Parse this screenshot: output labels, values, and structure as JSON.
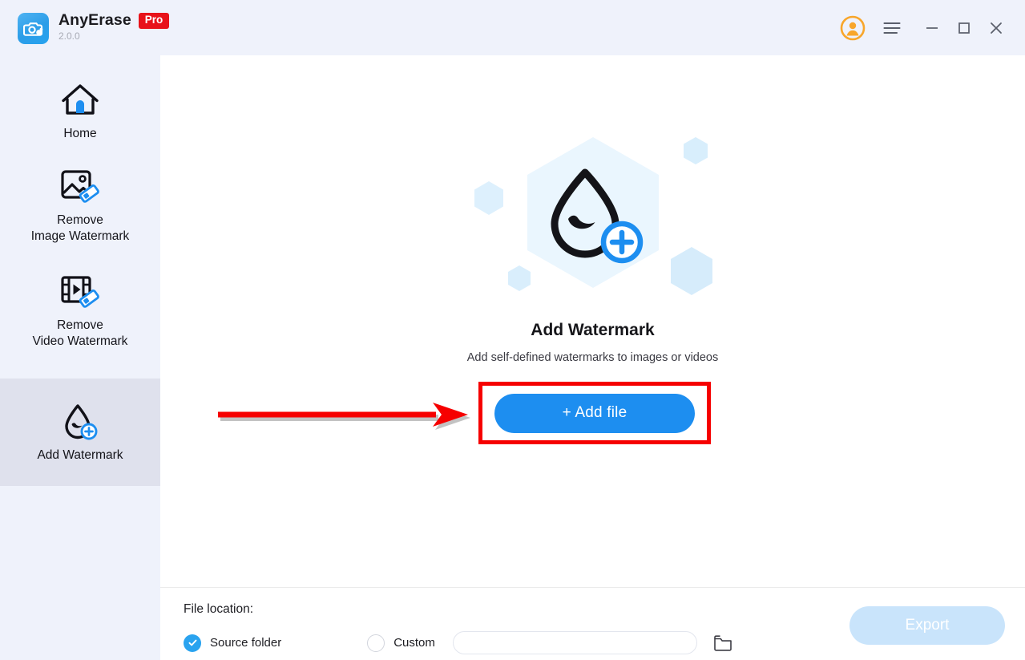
{
  "app": {
    "name": "AnyErase",
    "badge": "Pro",
    "version": "2.0.0",
    "logo_icon": "camera-erase-icon"
  },
  "window_controls": {
    "avatar": "account-avatar-icon",
    "menu": "hamburger-menu-icon",
    "minimize": "minimize-icon",
    "maximize": "maximize-icon",
    "close": "close-icon"
  },
  "sidebar": {
    "items": [
      {
        "id": "home",
        "label": "Home",
        "icon": "home-icon",
        "selected": false
      },
      {
        "id": "remove-image-watermark",
        "label": "Remove\nImage Watermark",
        "icon": "image-eraser-icon",
        "selected": false
      },
      {
        "id": "remove-video-watermark",
        "label": "Remove\nVideo Watermark",
        "icon": "video-eraser-icon",
        "selected": false
      },
      {
        "id": "add-watermark",
        "label": "Add Watermark",
        "icon": "droplet-plus-icon",
        "selected": true
      }
    ]
  },
  "main": {
    "hero_icon": "droplet-plus-hexagon-illustration",
    "title": "Add Watermark",
    "subtitle": "Add self-defined watermarks to images or videos",
    "add_file_label": "+ Add file"
  },
  "annotation": {
    "arrow": "red-arrow-pointing-right",
    "highlight": "red-rectangle-highlight",
    "arrow_color": "#f60000",
    "highlight_color": "#f60000"
  },
  "bottom_bar": {
    "file_location_label": "File location:",
    "options": [
      {
        "id": "source-folder",
        "label": "Source folder",
        "selected": true
      },
      {
        "id": "custom",
        "label": "Custom",
        "selected": false
      }
    ],
    "custom_path_value": "",
    "custom_path_placeholder": "",
    "browse_icon": "folder-icon",
    "export_label": "Export",
    "export_enabled": false
  },
  "colors": {
    "accent_blue": "#1d8ef0",
    "header_bg": "#eff2fb",
    "sidebar_selected_bg": "#dfe1ed",
    "pro_badge_red": "#e8131a",
    "annotation_red": "#f60000",
    "export_disabled_bg": "#c9e4fb",
    "avatar_orange": "#f8a62b"
  }
}
